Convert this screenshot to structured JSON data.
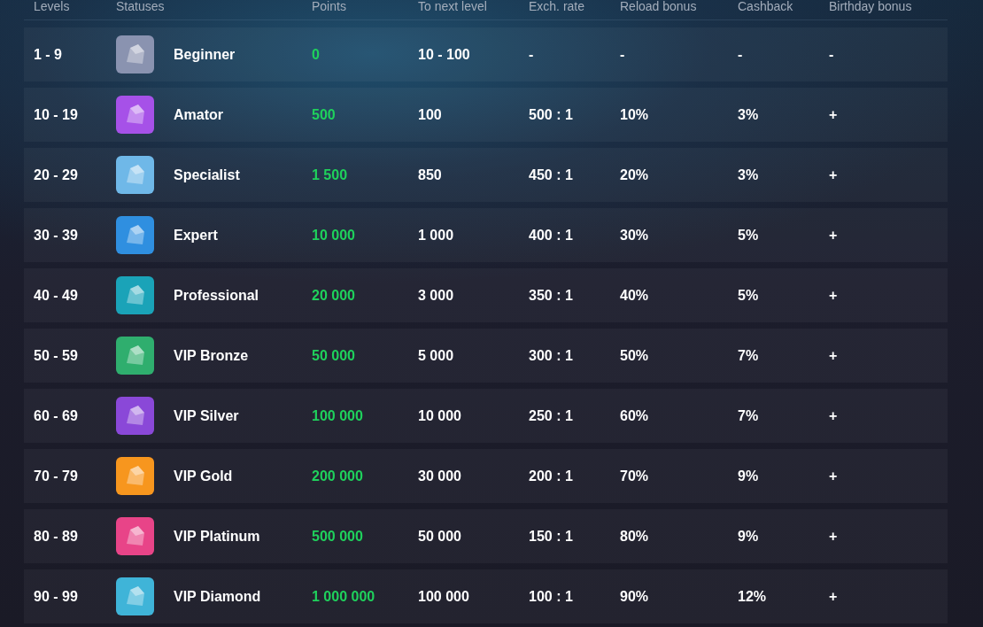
{
  "table": {
    "columns": [
      "Levels",
      "Statuses",
      "Points",
      "To next level",
      "Exch. rate",
      "Reload bonus",
      "Cashback",
      "Birthday bonus"
    ],
    "rows": [
      {
        "levels": "1 - 9",
        "status": "Beginner",
        "color": "#8a93b0",
        "points": "0",
        "to_next_level": "10 - 100",
        "exch_rate": "-",
        "reload_bonus": "-",
        "cashback": "-",
        "birthday_bonus": "-"
      },
      {
        "levels": "10 - 19",
        "status": "Amator",
        "color": "#a651e8",
        "points": "500",
        "to_next_level": "100",
        "exch_rate": "500 : 1",
        "reload_bonus": "10%",
        "cashback": "3%",
        "birthday_bonus": "+"
      },
      {
        "levels": "20 - 29",
        "status": "Specialist",
        "color": "#6fb8e8",
        "points": "1 500",
        "to_next_level": "850",
        "exch_rate": "450 : 1",
        "reload_bonus": "20%",
        "cashback": "3%",
        "birthday_bonus": "+"
      },
      {
        "levels": "30 - 39",
        "status": "Expert",
        "color": "#2f8fe0",
        "points": "10 000",
        "to_next_level": "1 000",
        "exch_rate": "400 : 1",
        "reload_bonus": "30%",
        "cashback": "5%",
        "birthday_bonus": "+"
      },
      {
        "levels": "40 - 49",
        "status": "Professional",
        "color": "#1aa3b8",
        "points": "20 000",
        "to_next_level": "3 000",
        "exch_rate": "350 : 1",
        "reload_bonus": "40%",
        "cashback": "5%",
        "birthday_bonus": "+"
      },
      {
        "levels": "50 - 59",
        "status": "VIP Bronze",
        "color": "#2fae6e",
        "points": "50 000",
        "to_next_level": "5 000",
        "exch_rate": "300 : 1",
        "reload_bonus": "50%",
        "cashback": "7%",
        "birthday_bonus": "+"
      },
      {
        "levels": "60 - 69",
        "status": "VIP Silver",
        "color": "#8a48d8",
        "points": "100 000",
        "to_next_level": "10 000",
        "exch_rate": "250 : 1",
        "reload_bonus": "60%",
        "cashback": "7%",
        "birthday_bonus": "+"
      },
      {
        "levels": "70 - 79",
        "status": "VIP Gold",
        "color": "#f7961e",
        "points": "200 000",
        "to_next_level": "30 000",
        "exch_rate": "200 : 1",
        "reload_bonus": "70%",
        "cashback": "9%",
        "birthday_bonus": "+"
      },
      {
        "levels": "80 - 89",
        "status": "VIP Platinum",
        "color": "#e84488",
        "points": "500 000",
        "to_next_level": "50 000",
        "exch_rate": "150 : 1",
        "reload_bonus": "80%",
        "cashback": "9%",
        "birthday_bonus": "+"
      },
      {
        "levels": "90 - 99",
        "status": "VIP Diamond",
        "color": "#3fb4d8",
        "points": "1 000 000",
        "to_next_level": "100 000",
        "exch_rate": "100 : 1",
        "reload_bonus": "90%",
        "cashback": "12%",
        "birthday_bonus": "+"
      }
    ]
  }
}
